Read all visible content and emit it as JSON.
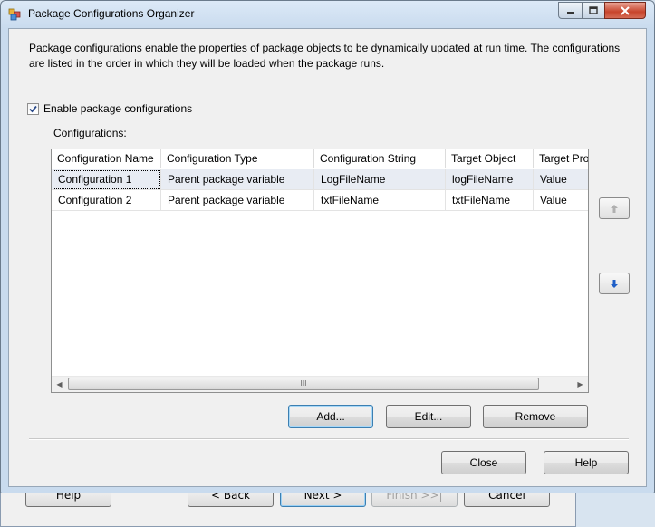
{
  "background_wizard": {
    "buttons": {
      "help": "Help",
      "back": "< Back",
      "next": "Next >",
      "finish": "Finish >>|",
      "cancel": "Cancel"
    }
  },
  "dialog": {
    "title": "Package Configurations Organizer",
    "description": "Package configurations enable the properties of package objects to be dynamically updated at run time. The configurations are listed in the order in which they will be loaded when the package runs.",
    "enable_checkbox": {
      "label": "Enable package configurations",
      "checked": true
    },
    "configurations_label": "Configurations:",
    "grid": {
      "columns": [
        "Configuration Name",
        "Configuration Type",
        "Configuration String",
        "Target Object",
        "Target Pro"
      ],
      "rows": [
        {
          "name": "Configuration 1",
          "type": "Parent package variable",
          "string": "LogFileName",
          "target_object": "logFileName",
          "target_property": "Value",
          "selected": true
        },
        {
          "name": "Configuration 2",
          "type": "Parent package variable",
          "string": "txtFileName",
          "target_object": "txtFileName",
          "target_property": "Value",
          "selected": false
        }
      ],
      "scroll_grip": "III"
    },
    "buttons": {
      "add": "Add...",
      "edit": "Edit...",
      "remove": "Remove",
      "close": "Close",
      "help": "Help"
    },
    "icons": {
      "move_up": "arrow-up-icon",
      "move_down": "arrow-down-icon",
      "accent_up": "#b0b0b0",
      "accent_down": "#1f5fc7"
    }
  }
}
